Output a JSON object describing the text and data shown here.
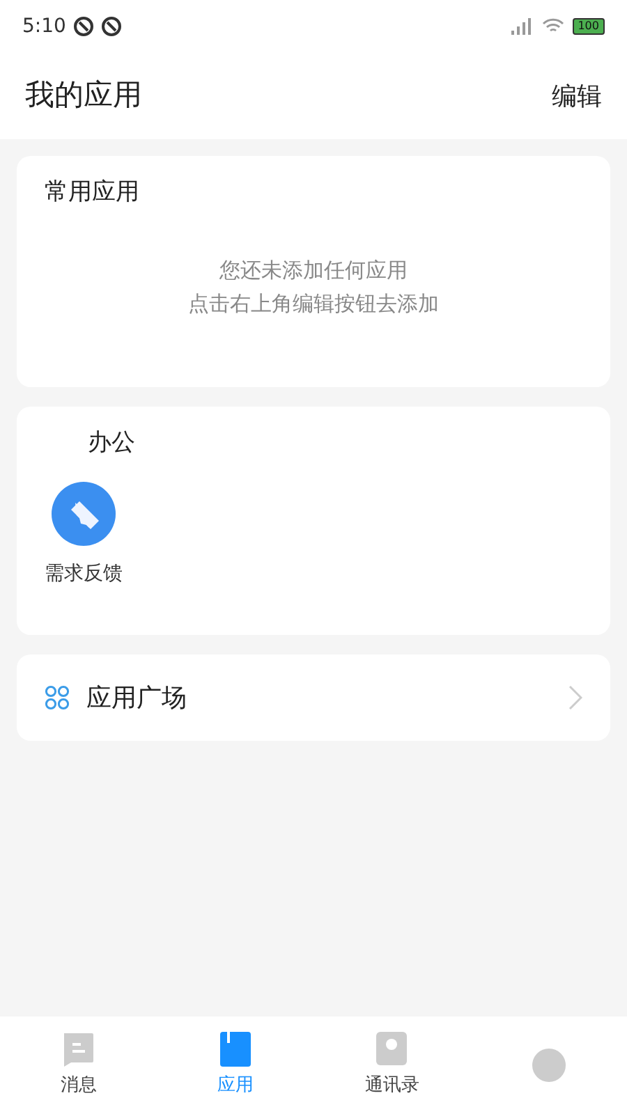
{
  "status_bar": {
    "time": "5:10",
    "battery": "100"
  },
  "header": {
    "title": "我的应用",
    "action": "编辑"
  },
  "common_apps": {
    "title": "常用应用",
    "empty_lines": [
      "您还未添加任何应用",
      "点击右上角编辑按钮去添加"
    ]
  },
  "office": {
    "title": "办公",
    "apps": [
      {
        "label": "需求反馈"
      }
    ]
  },
  "app_plaza": {
    "label": "应用广场"
  },
  "tabs": [
    {
      "kind": "message",
      "label": "消息",
      "selected": false
    },
    {
      "kind": "apps",
      "label": "应用",
      "selected": true
    },
    {
      "kind": "contacts",
      "label": "通讯录",
      "selected": false
    },
    {
      "kind": "profile",
      "selected": false
    }
  ]
}
